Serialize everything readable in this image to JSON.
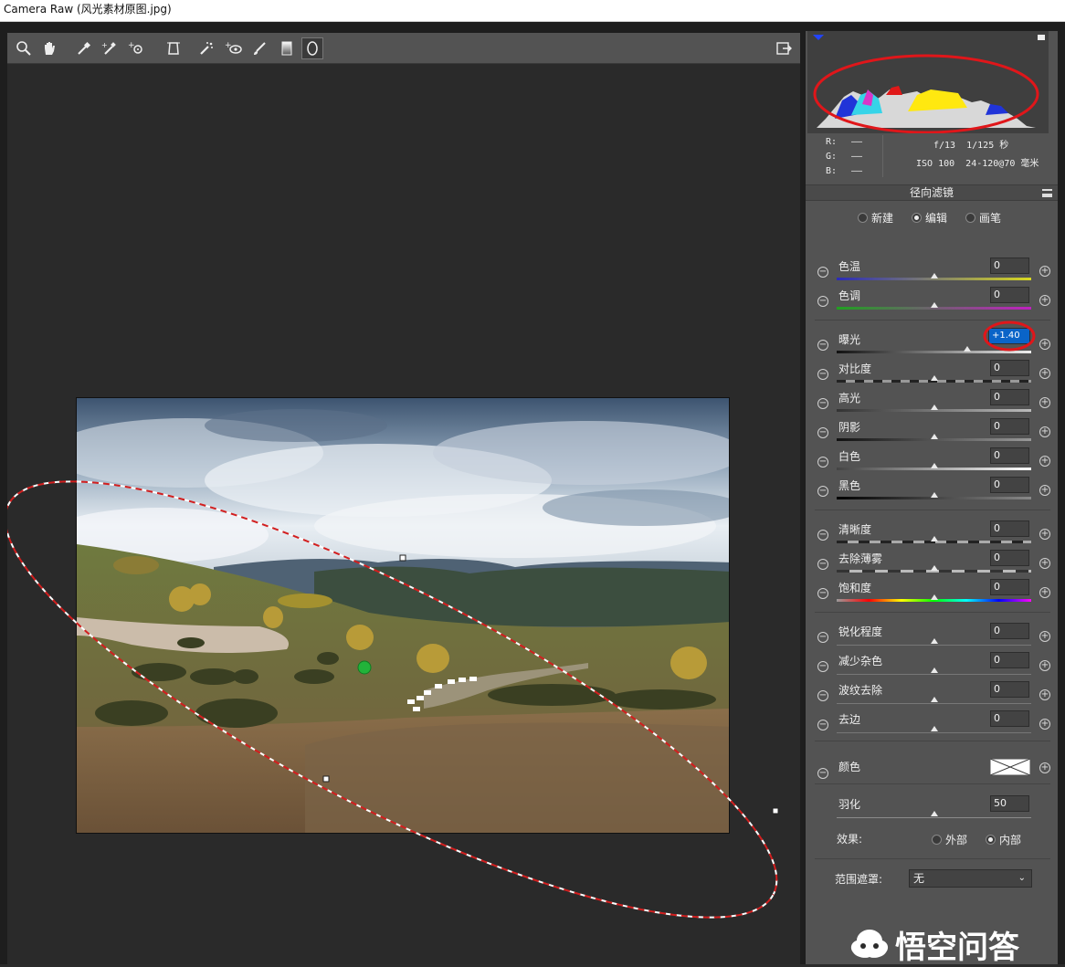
{
  "window": {
    "title": "Camera Raw (风光素材原图.jpg)"
  },
  "toolbar": {
    "tools": [
      "zoom-icon",
      "hand-icon",
      "white-balance-icon",
      "color-sampler-icon",
      "targeted-adjustment-icon",
      "transform-icon",
      "spot-removal-icon",
      "red-eye-icon",
      "adjustment-brush-icon",
      "graduated-filter-icon",
      "radial-filter-icon"
    ],
    "open_prefs_icon": "export-icon"
  },
  "histogram": {
    "rgb": {
      "r_label": "R:",
      "g_label": "G:",
      "b_label": "B:",
      "r_val": "——",
      "g_val": "——",
      "b_val": "——"
    },
    "aperture_shutter": "f/13  1/125 秒",
    "iso_lens": "ISO 100  24-120@70 毫米"
  },
  "panel": {
    "title": "径向滤镜",
    "modes": [
      {
        "label": "新建",
        "selected": false
      },
      {
        "label": "编辑",
        "selected": true
      },
      {
        "label": "画笔",
        "selected": false
      }
    ],
    "sliders": [
      {
        "label": "色温",
        "value": "0",
        "pos": 0.5
      },
      {
        "label": "色调",
        "value": "0",
        "pos": 0.5
      },
      {
        "label": "曝光",
        "value": "+1.40",
        "pos": 0.67
      },
      {
        "label": "对比度",
        "value": "0",
        "pos": 0.5
      },
      {
        "label": "高光",
        "value": "0",
        "pos": 0.5
      },
      {
        "label": "阴影",
        "value": "0",
        "pos": 0.5
      },
      {
        "label": "白色",
        "value": "0",
        "pos": 0.5
      },
      {
        "label": "黑色",
        "value": "0",
        "pos": 0.5
      },
      {
        "label": "清晰度",
        "value": "0",
        "pos": 0.5
      },
      {
        "label": "去除薄雾",
        "value": "0",
        "pos": 0.5
      },
      {
        "label": "饱和度",
        "value": "0",
        "pos": 0.5
      },
      {
        "label": "锐化程度",
        "value": "0",
        "pos": 0.5
      },
      {
        "label": "减少杂色",
        "value": "0",
        "pos": 0.5
      },
      {
        "label": "波纹去除",
        "value": "0",
        "pos": 0.5
      },
      {
        "label": "去边",
        "value": "0",
        "pos": 0.5
      }
    ],
    "color_label": "颜色",
    "feather_label": "羽化",
    "feather_value": "50",
    "feather_pos": 0.5,
    "effect_label": "效果:",
    "effect_options": [
      {
        "label": "外部",
        "selected": false
      },
      {
        "label": "内部",
        "selected": true
      }
    ],
    "range_mask_label": "范围遮罩:",
    "range_mask_value": "无"
  },
  "watermark": {
    "text": "悟空问答"
  },
  "colors": {
    "panel_bg": "#535353",
    "annotation_red": "#e0161a",
    "pin_green": "#22b33a"
  }
}
